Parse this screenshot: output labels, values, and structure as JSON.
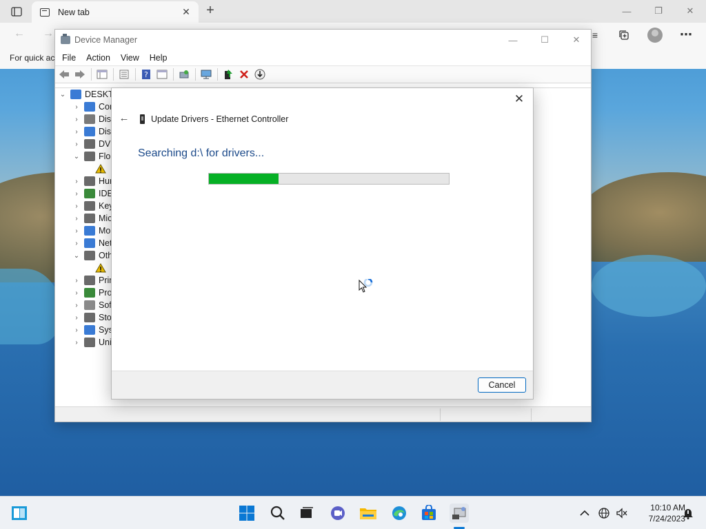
{
  "browser": {
    "tab_title": "New tab",
    "favbar_text": "For quick ac"
  },
  "devmgr": {
    "title": "Device Manager",
    "menu": [
      "File",
      "Action",
      "View",
      "Help"
    ],
    "tree_root": "DESKTO",
    "tree_items": [
      {
        "label": "Cor",
        "chev": "›",
        "icon": "computer-icon",
        "color": "#3a7bd5",
        "indent": 1
      },
      {
        "label": "Disk",
        "chev": "›",
        "icon": "disk-icon",
        "color": "#7a7a7a",
        "indent": 1
      },
      {
        "label": "Disp",
        "chev": "›",
        "icon": "display-icon",
        "color": "#3a7bd5",
        "indent": 1
      },
      {
        "label": "DVD",
        "chev": "›",
        "icon": "dvd-icon",
        "color": "#6a6a6a",
        "indent": 1
      },
      {
        "label": "Flop",
        "chev": "⌄",
        "icon": "floppy-icon",
        "color": "#6a6a6a",
        "indent": 1
      },
      {
        "label": "",
        "chev": "",
        "icon": "warning-device-icon",
        "color": "#f2c200",
        "indent": 2
      },
      {
        "label": "Hur",
        "chev": "›",
        "icon": "hid-icon",
        "color": "#6a6a6a",
        "indent": 1
      },
      {
        "label": "IDE",
        "chev": "›",
        "icon": "ide-icon",
        "color": "#3a8a3a",
        "indent": 1
      },
      {
        "label": "Key",
        "chev": "›",
        "icon": "keyboard-icon",
        "color": "#6a6a6a",
        "indent": 1
      },
      {
        "label": "Mic",
        "chev": "›",
        "icon": "mouse-icon",
        "color": "#6a6a6a",
        "indent": 1
      },
      {
        "label": "Mo",
        "chev": "›",
        "icon": "monitor-icon",
        "color": "#3a7bd5",
        "indent": 1
      },
      {
        "label": "Net",
        "chev": "›",
        "icon": "network-icon",
        "color": "#3a7bd5",
        "indent": 1
      },
      {
        "label": "Oth",
        "chev": "⌄",
        "icon": "other-devices-icon",
        "color": "#6a6a6a",
        "indent": 1
      },
      {
        "label": "",
        "chev": "",
        "icon": "warning-device-icon",
        "color": "#f2c200",
        "indent": 2
      },
      {
        "label": "Prir",
        "chev": "›",
        "icon": "printer-icon",
        "color": "#6a6a6a",
        "indent": 1
      },
      {
        "label": "Pro",
        "chev": "›",
        "icon": "processor-icon",
        "color": "#3a8a3a",
        "indent": 1
      },
      {
        "label": "Soft",
        "chev": "›",
        "icon": "software-icon",
        "color": "#8a8a8a",
        "indent": 1
      },
      {
        "label": "Stor",
        "chev": "›",
        "icon": "storage-icon",
        "color": "#6a6a6a",
        "indent": 1
      },
      {
        "label": "Syst",
        "chev": "›",
        "icon": "system-icon",
        "color": "#3a7bd5",
        "indent": 1
      },
      {
        "label": "Uni",
        "chev": "›",
        "icon": "usb-icon",
        "color": "#6a6a6a",
        "indent": 1
      }
    ]
  },
  "dialog": {
    "title": "Update Drivers - Ethernet Controller",
    "heading": "Searching d:\\ for drivers...",
    "progress_percent": 29,
    "cancel_label": "Cancel"
  },
  "taskbar": {
    "time": "10:10 AM",
    "date": "7/24/2023",
    "apps": [
      "start-icon",
      "search-icon",
      "task-view-icon",
      "chat-icon",
      "file-explorer-icon",
      "edge-icon",
      "store-icon",
      "device-manager-icon"
    ]
  },
  "colors": {
    "accent": "#0067c0",
    "progress": "#06b025",
    "heading": "#1c4a8a"
  }
}
